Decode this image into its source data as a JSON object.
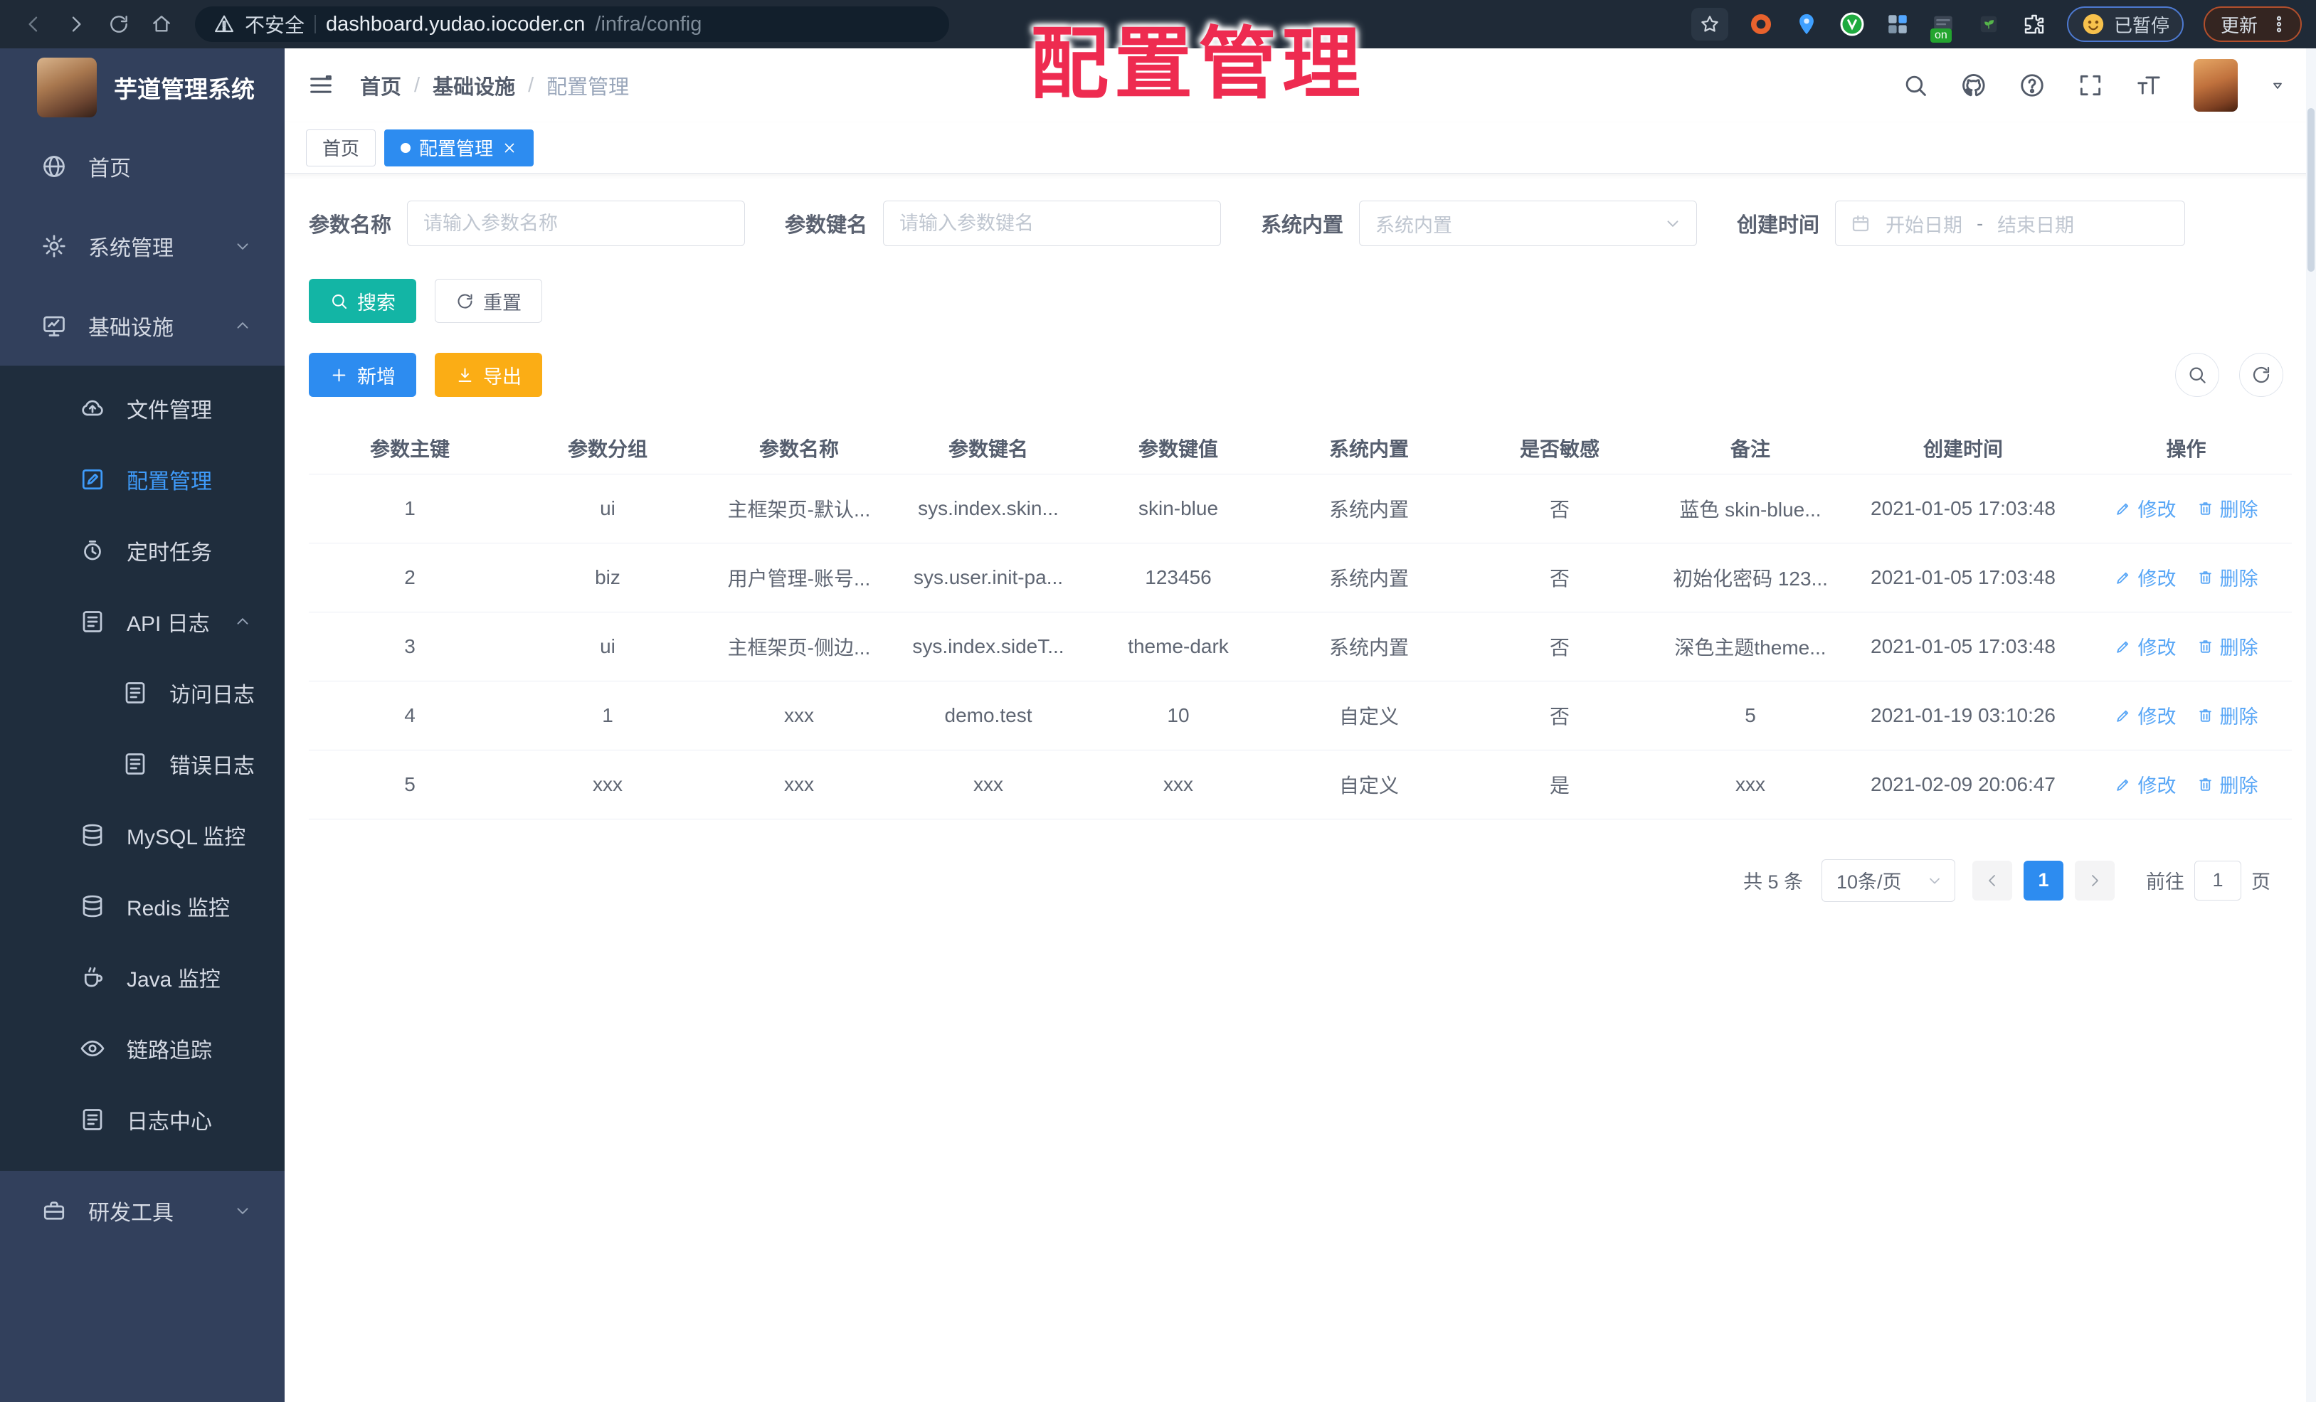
{
  "browser": {
    "security_label": "不安全",
    "url_host": "dashboard.yudao.iocoder.cn",
    "url_path": "/infra/config",
    "paused_label": "已暂停",
    "update_label": "更新",
    "ext_on_badge": "on"
  },
  "overlay_title": "配置管理",
  "sidebar": {
    "app_title": "芋道管理系统",
    "items": [
      {
        "label": "首页"
      },
      {
        "label": "系统管理"
      },
      {
        "label": "基础设施"
      },
      {
        "label": "文件管理"
      },
      {
        "label": "配置管理"
      },
      {
        "label": "定时任务"
      },
      {
        "label": "API 日志"
      },
      {
        "label": "访问日志"
      },
      {
        "label": "错误日志"
      },
      {
        "label": "MySQL 监控"
      },
      {
        "label": "Redis 监控"
      },
      {
        "label": "Java 监控"
      },
      {
        "label": "链路追踪"
      },
      {
        "label": "日志中心"
      },
      {
        "label": "研发工具"
      }
    ]
  },
  "header": {
    "breadcrumb": [
      "首页",
      "基础设施",
      "配置管理"
    ],
    "separator": "/"
  },
  "tabs": [
    {
      "label": "首页"
    },
    {
      "label": "配置管理"
    }
  ],
  "filters": {
    "name_label": "参数名称",
    "name_placeholder": "请输入参数名称",
    "key_label": "参数键名",
    "key_placeholder": "请输入参数键名",
    "builtin_label": "系统内置",
    "builtin_placeholder": "系统内置",
    "date_label": "创建时间",
    "date_start_placeholder": "开始日期",
    "date_separator": "-",
    "date_end_placeholder": "结束日期"
  },
  "toolbar": {
    "search_label": "搜索",
    "reset_label": "重置",
    "add_label": "新增",
    "export_label": "导出"
  },
  "table": {
    "columns": [
      "参数主键",
      "参数分组",
      "参数名称",
      "参数键名",
      "参数键值",
      "系统内置",
      "是否敏感",
      "备注",
      "创建时间",
      "操作"
    ],
    "rows": [
      [
        "1",
        "ui",
        "主框架页-默认...",
        "sys.index.skin...",
        "skin-blue",
        "系统内置",
        "否",
        "蓝色 skin-blue...",
        "2021-01-05 17:03:48"
      ],
      [
        "2",
        "biz",
        "用户管理-账号...",
        "sys.user.init-pa...",
        "123456",
        "系统内置",
        "否",
        "初始化密码 123...",
        "2021-01-05 17:03:48"
      ],
      [
        "3",
        "ui",
        "主框架页-侧边...",
        "sys.index.sideT...",
        "theme-dark",
        "系统内置",
        "否",
        "深色主题theme...",
        "2021-01-05 17:03:48"
      ],
      [
        "4",
        "1",
        "xxx",
        "demo.test",
        "10",
        "自定义",
        "否",
        "5",
        "2021-01-19 03:10:26"
      ],
      [
        "5",
        "xxx",
        "xxx",
        "xxx",
        "xxx",
        "自定义",
        "是",
        "xxx",
        "2021-02-09 20:06:47"
      ]
    ],
    "edit_label": "修改",
    "delete_label": "删除"
  },
  "pagination": {
    "total": "共 5 条",
    "page_size": "10条/页",
    "current_page": "1",
    "goto_label": "前往",
    "goto_value": "1",
    "page_unit": "页"
  },
  "colors": {
    "accent_blue": "#2d8cf0",
    "teal": "#13b5a5",
    "amber": "#fbad15",
    "link_blue": "#58a6f6",
    "overlay_red": "#ee2b50",
    "sidebar_bg": "#32405c",
    "submenu_bg": "#1f2d3d"
  }
}
